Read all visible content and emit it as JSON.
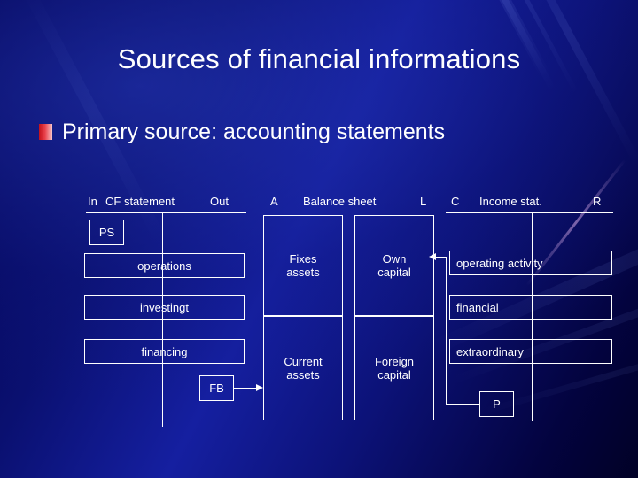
{
  "slide": {
    "title": "Sources of financial informations",
    "bullet": {
      "marker": "square-bullet-icon",
      "text": "Primary source: accounting statements"
    }
  },
  "diagram": {
    "sections": [
      {
        "id": "cf",
        "left_label": "In",
        "name": "CF statement",
        "right_label": "Out"
      },
      {
        "id": "bs",
        "left_label": "A",
        "name": "Balance sheet",
        "right_label": "L"
      },
      {
        "id": "is",
        "left_label": "C",
        "name": "Income stat.",
        "right_label": "R"
      }
    ],
    "headers": {
      "cf_full": "In  CF statement   Out",
      "cf_in": "In",
      "cf_name": "CF statement",
      "cf_out": "Out",
      "bs_a": "A",
      "bs_name": "Balance sheet",
      "bs_l": "L",
      "is_c": "C",
      "is_name": "Income stat.",
      "is_r": "R"
    },
    "cash_flow": {
      "opening_balance": "PS",
      "closing_balance": "FB",
      "rows": [
        {
          "label": "operations"
        },
        {
          "label": "investingt"
        },
        {
          "label": "financing"
        }
      ]
    },
    "balance_sheet": {
      "assets": [
        {
          "label": "Fixes\nassets"
        },
        {
          "label": "Current\nassets"
        }
      ],
      "liabilities": [
        {
          "label": "Own\ncapital"
        },
        {
          "label": "Foreign\ncapital"
        }
      ]
    },
    "income_statement": {
      "profit": "P",
      "rows": [
        {
          "label": "operating activity"
        },
        {
          "label": "financial"
        },
        {
          "label": "extraordinary"
        }
      ]
    },
    "connectors": [
      {
        "from": "FB",
        "to": "Current assets",
        "direction": "right"
      },
      {
        "from": "P",
        "to": "Own capital",
        "direction": "left-up"
      }
    ]
  },
  "colors": {
    "background_dark": "#00004d",
    "background_mid": "#151fa0",
    "text": "#ffffff",
    "bullet_accent": "#c4121c"
  }
}
